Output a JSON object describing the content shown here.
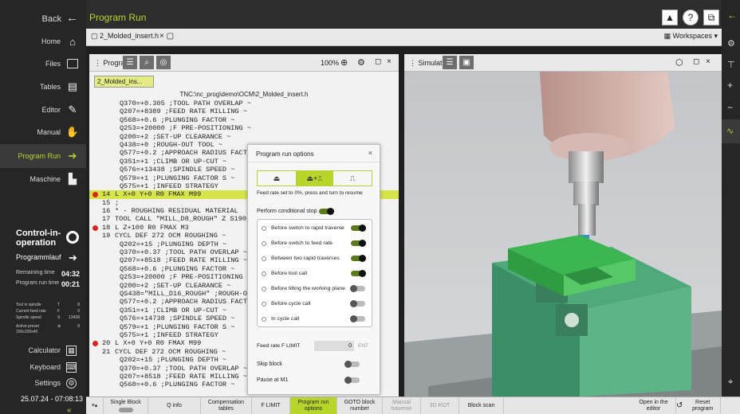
{
  "sidebar": {
    "back": "Back",
    "items": [
      {
        "label": "Home",
        "icon": "home-icon"
      },
      {
        "label": "Files",
        "icon": "folder-icon"
      },
      {
        "label": "Tables",
        "icon": "table-icon"
      },
      {
        "label": "Editor",
        "icon": "editor-icon"
      },
      {
        "label": "Manual",
        "icon": "hand-icon"
      },
      {
        "label": "Program Run",
        "icon": "program-run-icon"
      },
      {
        "label": "Maschine",
        "icon": "machine-icon"
      }
    ],
    "control_title": "Control-in-operation",
    "program_label": "Programmlauf",
    "remaining_label": "Remaining time",
    "remaining_value": "04:32",
    "runtime_label": "Program run time",
    "runtime_value": "00:21",
    "status_rows": [
      {
        "label": "Tool in spindle",
        "key": "T",
        "value": "8"
      },
      {
        "label": "Current feed rate",
        "key": "F",
        "value": "0"
      },
      {
        "label": "Spindle speed",
        "key": "S",
        "value": "13438"
      },
      {
        "label": "Active preset",
        "key": "⊕",
        "value": "8"
      }
    ],
    "preset_sub": "100x100x40",
    "tools": [
      {
        "label": "Calculator"
      },
      {
        "label": "Keyboard"
      },
      {
        "label": "Settings"
      }
    ],
    "datetime": "25.07.24 - 07:08:13"
  },
  "header": {
    "title": "Program Run"
  },
  "filebar": {
    "tab": "2_Molded_insert.h",
    "workspaces": "Workspaces"
  },
  "program": {
    "panel_label": "Program",
    "zoom": "100%",
    "tag": "2_Molded_ins...",
    "path": "TNC:\\nc_prog\\demo\\OCM\\2_Molded_insert.h"
  },
  "code_lines": [
    {
      "n": "",
      "t": "Q370=+0.305 ;TOOL PATH OVERLAP ~",
      "ind": true
    },
    {
      "n": "",
      "t": "Q207=+8389 ;FEED RATE MILLING ~",
      "ind": true
    },
    {
      "n": "",
      "t": "Q568=+0.6 ;PLUNGING FACTOR ~",
      "ind": true
    },
    {
      "n": "",
      "t": "Q253=+20000 ;F PRE-POSITIONING ~",
      "ind": true
    },
    {
      "n": "",
      "t": "Q200=+2 ;SET-UP CLEARANCE ~",
      "ind": true
    },
    {
      "n": "",
      "t": "Q438=+0 ;ROUGH-OUT TOOL ~",
      "ind": true
    },
    {
      "n": "",
      "t": "Q577=+0.2 ;APPROACH RADIUS FACT",
      "ind": true
    },
    {
      "n": "",
      "t": "Q351=+1 ;CLIMB OR UP-CUT ~",
      "ind": true
    },
    {
      "n": "",
      "t": "Q576=+13438 ;SPINDLE SPEED ~",
      "ind": true
    },
    {
      "n": "",
      "t": "Q579=+1 ;PLUNGING FACTOR S ~",
      "ind": true
    },
    {
      "n": "",
      "t": "Q575=+1 ;INFEED STRATEGY",
      "ind": true
    },
    {
      "n": "14",
      "t": "L X+0 Y+0 R0 FMAX M99",
      "dot": true,
      "hl": true
    },
    {
      "n": "15",
      "t": ";"
    },
    {
      "n": "16",
      "t": "* - ROUGHING RESIDUAL MATERIAL"
    },
    {
      "n": "17",
      "t": "TOOL CALL \"MILL_D8_ROUGH\" Z S190"
    },
    {
      "n": "18",
      "t": "L Z+100 R0 FMAX M3",
      "dot": true
    },
    {
      "n": "19",
      "t": "CYCL DEF 272 OCM ROUGHING ~"
    },
    {
      "n": "",
      "t": "Q202=+15 ;PLUNGING DEPTH ~",
      "ind": true
    },
    {
      "n": "",
      "t": "Q370=+0.37 ;TOOL PATH OVERLAP ~",
      "ind": true
    },
    {
      "n": "",
      "t": "Q207=+8518 ;FEED RATE MILLING ~",
      "ind": true
    },
    {
      "n": "",
      "t": "Q568=+0.6 ;PLUNGING FACTOR ~",
      "ind": true
    },
    {
      "n": "",
      "t": "Q253=+20000 ;F PRE-POSITIONING",
      "ind": true
    },
    {
      "n": "",
      "t": "Q200=+2 ;SET-UP CLEARANCE ~",
      "ind": true
    },
    {
      "n": "",
      "t": "QS438=\"MILL_D16_ROUGH\" ;ROUGH-O",
      "ind": true
    },
    {
      "n": "",
      "t": "Q577=+0.2 ;APPROACH RADIUS FACT",
      "ind": true
    },
    {
      "n": "",
      "t": "Q351=+1 ;CLIMB OR UP-CUT ~",
      "ind": true
    },
    {
      "n": "",
      "t": "Q576=+14738 ;SPINDLE SPEED ~",
      "ind": true
    },
    {
      "n": "",
      "t": "Q579=+1 ;PLUNGING FACTOR S ~",
      "ind": true
    },
    {
      "n": "",
      "t": "Q575=+1 ;INFEED STRATEGY",
      "ind": true
    },
    {
      "n": "20",
      "t": "L X+0 Y+0 R0 FMAX M99",
      "dot": true
    },
    {
      "n": "21",
      "t": "CYCL DEF 272 OCM ROUGHING ~"
    },
    {
      "n": "",
      "t": "Q202=+15 ;PLUNGING DEPTH ~",
      "ind": true
    },
    {
      "n": "",
      "t": "Q370=+0.37 ;TOOL PATH OVERLAP ~",
      "ind": true
    },
    {
      "n": "",
      "t": "Q207=+8518 ;FEED RATE MILLING ~",
      "ind": true
    },
    {
      "n": "",
      "t": "Q568=+0.6 ;PLUNGING FACTOR ~",
      "ind": true
    }
  ],
  "dialog": {
    "title": "Program run options",
    "note": "Feed rate set to 0%, press and turn to resume",
    "conditional_stop": "Perform conditional stop",
    "options": [
      {
        "label": "Before switch to rapid traverse",
        "on": true
      },
      {
        "label": "Before switch to feed rate",
        "on": true
      },
      {
        "label": "Between two rapid traverses",
        "on": true
      },
      {
        "label": "Before tool call",
        "on": true
      },
      {
        "label": "Before tilting the working plane",
        "on": false
      },
      {
        "label": "Before cycle call",
        "on": false
      },
      {
        "label": "In cycle call",
        "on": false
      }
    ],
    "feed_limit_label": "Feed rate F LIMIT",
    "feed_limit_value": "0",
    "ent": "ENT",
    "skip_block": "Skip block",
    "pause_m1": "Pause at M1"
  },
  "simulation": {
    "panel_label": "Simulation"
  },
  "bottom": {
    "single_block": "Single Block",
    "q_info": "Q info",
    "comp_tables": "Compensation tables",
    "f_limit": "F LIMIT",
    "prog_run_options": "Program run options",
    "goto": "GOTO block number",
    "manual_traverse": "Manual traverse",
    "rot": "3D ROT",
    "block_scan": "Block scan",
    "open_editor": "Open in the editor",
    "reset_program": "Reset program"
  },
  "colors": {
    "accent": "#b7d62b",
    "highlight": "#d6e44a",
    "breakpoint": "#d8261e"
  }
}
